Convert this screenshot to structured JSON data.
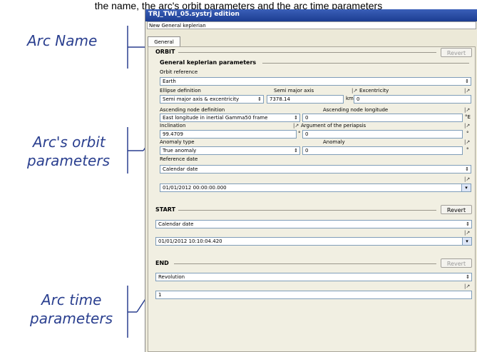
{
  "caption": "the name, the arc's orbit parameters and the arc time parameters",
  "annotations": {
    "arc_name": "Arc Name",
    "orbit_line1": "Arc's orbit",
    "orbit_line2": "parameters",
    "time_line1": "Arc time",
    "time_line2": "parameters"
  },
  "window": {
    "title": "TRJ_TWI_05.systrj edition",
    "arc_name_value": "New General keplerian",
    "tab_general": "General",
    "revert_label": "Revert"
  },
  "orbit": {
    "section_label": "ORBIT",
    "group_title": "General keplerian parameters",
    "orbit_reference_label": "Orbit reference",
    "orbit_reference_value": "Earth",
    "ellipse_definition_label": "Ellipse definition",
    "ellipse_definition_value": "Semi major axis & excentricity",
    "semi_major_axis_label": "Semi major axis",
    "semi_major_axis_value": "7378.14",
    "semi_major_axis_unit": "km",
    "eccentricity_label": "Excentricity",
    "eccentricity_value": "0",
    "ascending_node_def_label": "Ascending node definition",
    "ascending_node_def_value": "East longitude in inertial Gamma50 frame",
    "ascending_node_longitude_label": "Ascending node longitude",
    "ascending_node_longitude_value": "0",
    "ascending_node_longitude_unit": "°E",
    "inclination_label": "Inclination",
    "inclination_value": "99.4709",
    "inclination_unit": "°",
    "periapsis_label": "Argument of the periapsis",
    "periapsis_value": "0",
    "periapsis_unit": "°",
    "anomaly_type_label": "Anomaly type",
    "anomaly_type_value": "True anomaly",
    "anomaly_label": "Anomaly",
    "anomaly_value": "0",
    "anomaly_unit": "°",
    "reference_date_label": "Reference date",
    "reference_date_type": "Calendar date",
    "reference_date_value": "01/01/2012 00:00:00.000"
  },
  "start": {
    "section_label": "START",
    "date_type": "Calendar date",
    "date_value": "01/01/2012 10:10:04.420"
  },
  "end": {
    "section_label": "END",
    "type": "Revolution",
    "value": "1"
  },
  "icons": {
    "variable": "variable-toggle-icon",
    "spin": "spinner-arrows-icon",
    "dropdown": "dropdown-arrow-icon"
  }
}
